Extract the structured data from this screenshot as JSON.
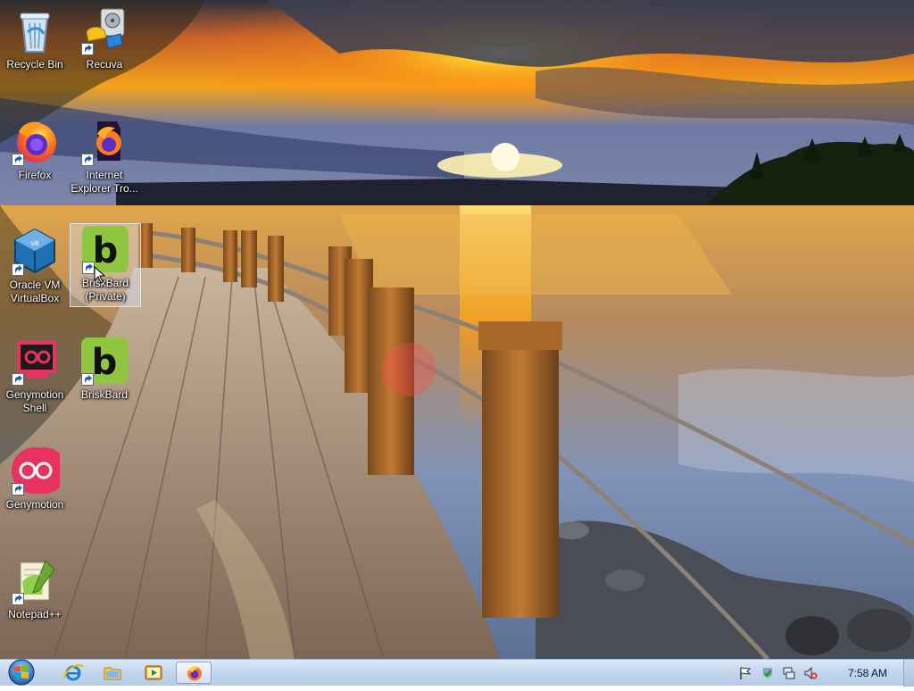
{
  "desktop": {
    "icons": [
      {
        "label": "Recycle Bin",
        "icon": "recycle-bin-icon",
        "shortcut": false
      },
      {
        "label": "Recuva",
        "icon": "recuva-icon",
        "shortcut": true
      },
      {
        "label": "Firefox",
        "icon": "firefox-icon",
        "shortcut": true
      },
      {
        "label": "Internet Explorer Tro...",
        "icon": "firefox-dark-icon",
        "shortcut": true
      },
      {
        "label": "Oracle VM VirtualBox",
        "icon": "virtualbox-icon",
        "shortcut": true
      },
      {
        "label": "BriskBard (Private)",
        "icon": "briskbard-icon",
        "shortcut": true,
        "selected": true
      },
      {
        "label": "Genymotion Shell",
        "icon": "genymotion-shell-icon",
        "shortcut": true
      },
      {
        "label": "BriskBard",
        "icon": "briskbard-icon",
        "shortcut": true
      },
      {
        "label": "Genymotion",
        "icon": "genymotion-icon",
        "shortcut": true
      },
      {
        "label": "Notepad++",
        "icon": "notepadpp-icon",
        "shortcut": true
      }
    ]
  },
  "taskbar": {
    "start": "windows-start-icon",
    "pinned": [
      "internet-explorer-icon",
      "file-explorer-icon",
      "media-player-icon",
      "firefox-icon"
    ],
    "tray": [
      "action-center-flag-icon",
      "security-check-icon",
      "network-icon",
      "volume-muted-icon"
    ],
    "clock": "7:58 AM"
  },
  "colors": {
    "taskbar": "#c4d7ee",
    "brisk_green": "#8fc63f",
    "genymotion_pink": "#e8325f"
  }
}
